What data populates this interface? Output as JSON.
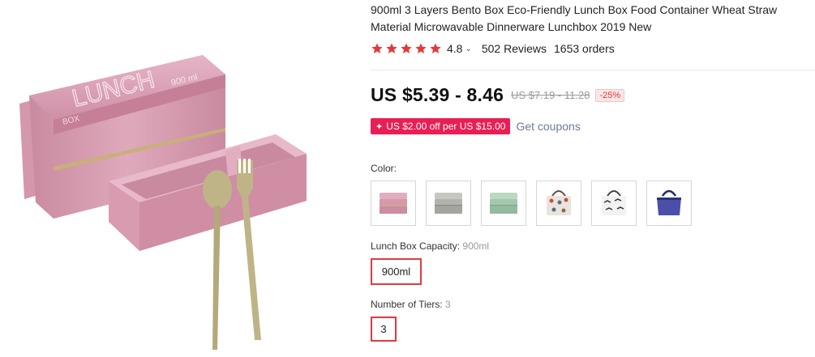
{
  "product": {
    "title": "900ml 3 Layers Bento Box Eco-Friendly Lunch Box Food Container Wheat Straw Material Microwavable Dinnerware Lunchbox 2019 New",
    "image_lid_text": "LUNCH",
    "image_box_text": "BOX",
    "image_capacity_text": "900 ml"
  },
  "rating": {
    "value": "4.8",
    "caret": "⌄",
    "reviews": "502 Reviews",
    "orders": "1653 orders",
    "star_count": 5,
    "star_color": "#e4393c"
  },
  "pricing": {
    "price": "US $5.39 - 8.46",
    "original": "US $7.19 - 11.28",
    "discount": "-25%"
  },
  "coupon": {
    "icon": "✦",
    "text": "US $2.00 off per US $15.00",
    "link": "Get coupons"
  },
  "color": {
    "label": "Color:",
    "options": [
      "pink-bento-box",
      "gray-bento-box",
      "green-bento-box",
      "patterned-lunch-bag",
      "cloud-print-lunch-bag",
      "purple-lunch-bag"
    ]
  },
  "capacity": {
    "label": "Lunch Box Capacity:",
    "selected": "900ml",
    "option": "900ml"
  },
  "tiers": {
    "label": "Number of Tiers:",
    "selected": "3",
    "option": "3"
  }
}
